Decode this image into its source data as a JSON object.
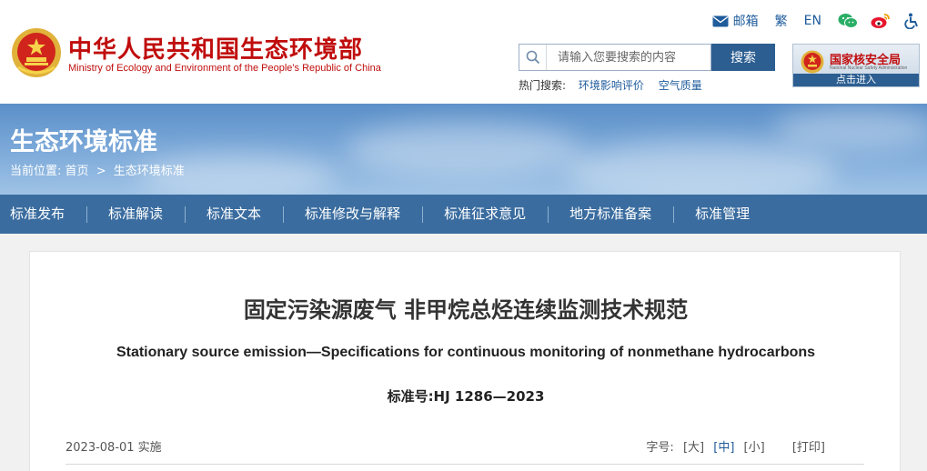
{
  "header": {
    "logo_cn": "中华人民共和国生态环境部",
    "logo_en": "Ministry of Ecology and Environment of the People's Republic of China",
    "top_links": {
      "mail": "邮箱",
      "traditional": "繁",
      "english": "EN"
    },
    "icons": [
      "mail-icon",
      "wechat-icon",
      "weibo-icon",
      "accessibility-icon"
    ],
    "search": {
      "placeholder": "请输入您要搜索的内容",
      "button": "搜索"
    },
    "hot_search": {
      "label": "热门搜索:",
      "links": [
        "环境影响评价",
        "空气质量"
      ]
    },
    "nnsa": {
      "name": "国家核安全局",
      "name_en": "National Nuclear Safety Administration",
      "enter": "点击进入"
    }
  },
  "banner": {
    "title": "生态环境标准",
    "breadcrumb": {
      "prefix": "当前位置:",
      "home": "首页",
      "separator": ">",
      "current": "生态环境标准"
    }
  },
  "nav": {
    "items": [
      "标准发布",
      "标准解读",
      "标准文本",
      "标准修改与解释",
      "标准征求意见",
      "地方标准备案",
      "标准管理"
    ]
  },
  "article": {
    "title": "固定污染源废气 非甲烷总烃连续监测技术规范",
    "title_en": "Stationary source emission—Specifications for continuous monitoring of nonmethane hydrocarbons",
    "standard_no": "标准号:HJ 1286—2023",
    "date": "2023-08-01 实施",
    "font_size_label": "字号:",
    "font_sizes": [
      "[大]",
      "[中]",
      "[小]"
    ],
    "print": "[打印]"
  },
  "colors": {
    "brand_red": "#c00d0d",
    "nav_blue": "#3a6c9f",
    "button_blue": "#2c5e91",
    "link_blue": "#1f5c9c"
  }
}
